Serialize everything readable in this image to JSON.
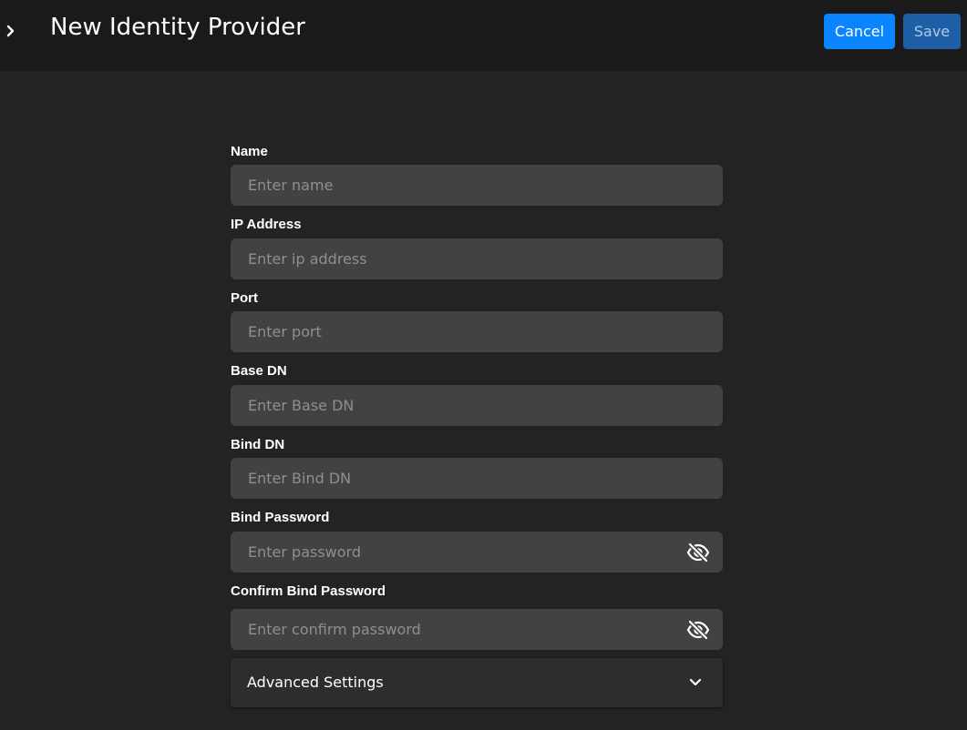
{
  "header": {
    "title": "New Identity Provider",
    "expand_icon": "chevron-right-icon",
    "cancel_label": "Cancel",
    "save_label": "Save"
  },
  "form": {
    "fields": [
      {
        "label": "Name",
        "placeholder": "Enter name",
        "value": ""
      },
      {
        "label": "IP Address",
        "placeholder": "Enter ip address",
        "value": ""
      },
      {
        "label": "Port",
        "placeholder": "Enter port",
        "value": ""
      },
      {
        "label": "Base DN",
        "placeholder": "Enter Base DN",
        "value": ""
      },
      {
        "label": "Bind DN",
        "placeholder": "Enter Bind DN",
        "value": ""
      },
      {
        "label": "Bind Password",
        "placeholder": "Enter password",
        "value": "",
        "toggle_icon": "eye-off-icon"
      },
      {
        "label": "Confirm Bind Password",
        "placeholder": "Enter confirm password",
        "value": "",
        "toggle_icon": "eye-off-icon"
      }
    ],
    "advanced": {
      "label": "Advanced Settings",
      "icon": "chevron-down-icon",
      "expanded": false
    }
  },
  "colors": {
    "background": "#232323",
    "header_background": "#1a1a1a",
    "input_background": "#424242",
    "primary_button": "#0a84ff",
    "save_button": "#1e5fa8",
    "placeholder_text": "#8f8f8f"
  }
}
